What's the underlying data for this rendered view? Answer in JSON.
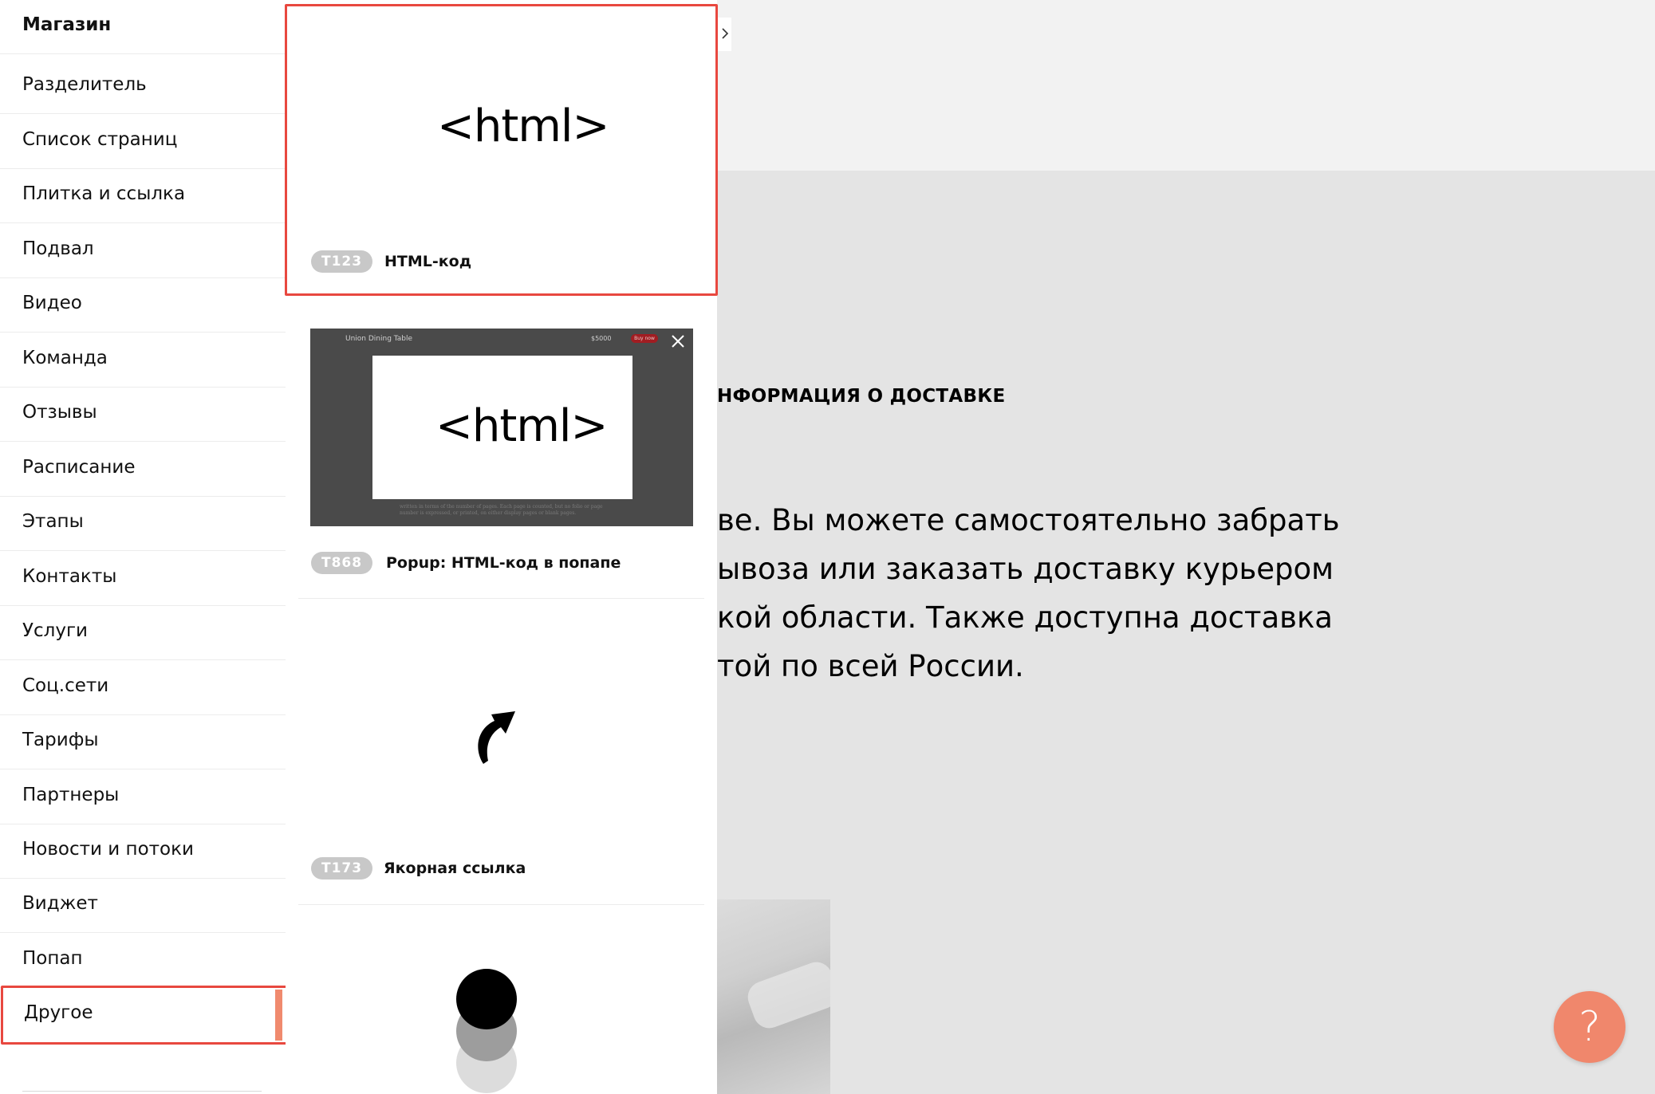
{
  "sidebar": {
    "categories": [
      "Магазин",
      "Разделитель",
      "Список страниц",
      "Плитка и ссылка",
      "Подвал",
      "Видео",
      "Команда",
      "Отзывы",
      "Расписание",
      "Этапы",
      "Контакты",
      "Услуги",
      "Соц.сети",
      "Тарифы",
      "Партнеры",
      "Новости и потоки",
      "Виджет",
      "Попап",
      "Другое"
    ],
    "selected": "Другое"
  },
  "blocks": [
    {
      "code": "T123",
      "title": "HTML-код",
      "preview_text": "<html>"
    },
    {
      "code": "T868",
      "title": "Popup: HTML-код в попапе",
      "preview_text": "<html>",
      "preview_header": "Union Dining Table",
      "preview_price": "$5000",
      "preview_button": "Buy now",
      "preview_footnote": "written in terms of the number of pages. Each page is counted, but no folio or page number is expressed, or printed, on either display pages or blank pages."
    },
    {
      "code": "T173",
      "title": "Якорная ссылка"
    },
    {
      "code": "",
      "title": ""
    }
  ],
  "background_page": {
    "heading": "НФОРМАЦИЯ О ДОСТАВКЕ",
    "text_lines": [
      "ве. Вы можете самостоятельно забрать",
      "ывоза или заказать доставку курьером",
      "кой области. Также доступна доставка",
      "той по всей России."
    ]
  },
  "help_button": {
    "label": "?"
  },
  "colors": {
    "highlight": "#e8483f",
    "accent": "#f08a6e",
    "badge": "#c8c8c8",
    "help": "#f0876c"
  },
  "icons": {
    "arrow": "curved-arrow-icon",
    "close": "close-icon",
    "chevron": "chevron-right-icon",
    "circles": "fading-circles-icon"
  }
}
